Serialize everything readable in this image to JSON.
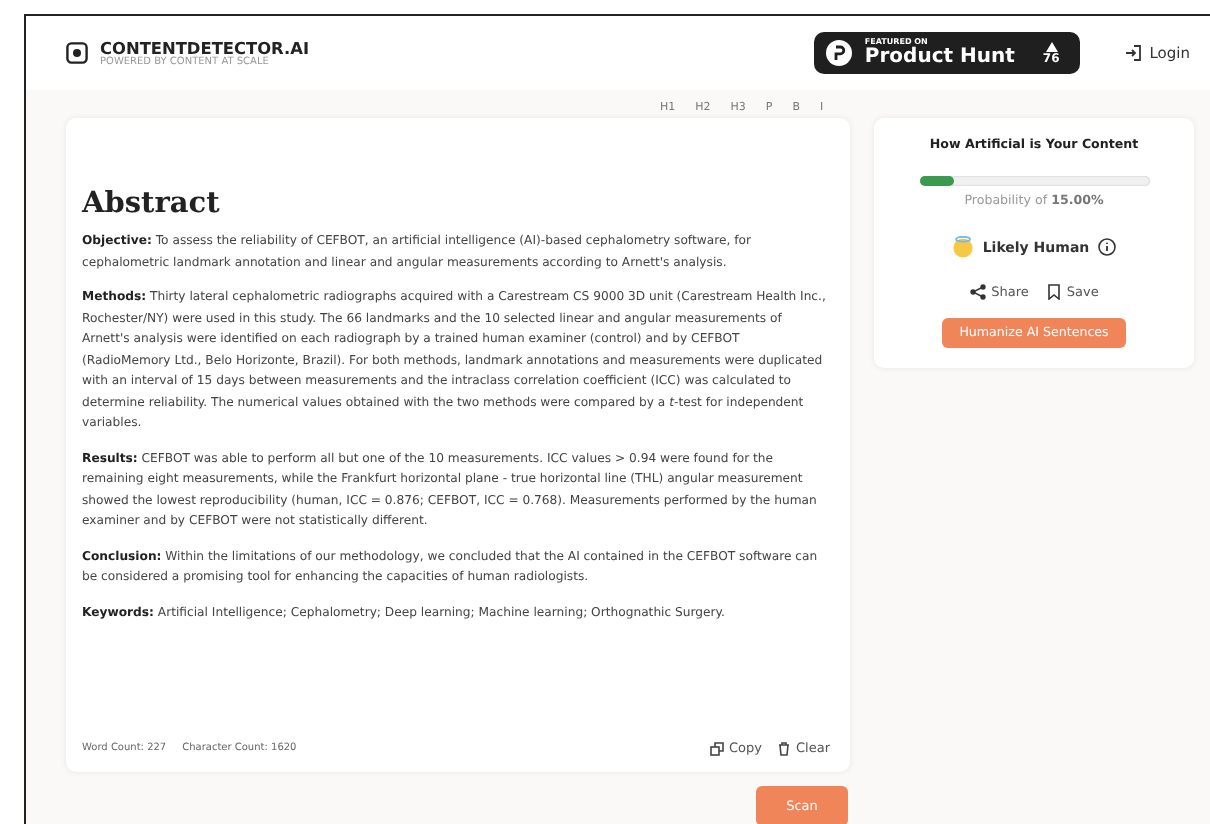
{
  "header": {
    "brand": "CONTENTDETECTOR.AI",
    "tagline": "POWERED BY CONTENT AT SCALE",
    "badge": {
      "small": "FEATURED ON",
      "name": "Product Hunt",
      "votes": "76"
    },
    "login": "Login"
  },
  "toolbar": [
    "H1",
    "H2",
    "H3",
    "P",
    "B",
    "I"
  ],
  "editor": {
    "heading": "Abstract",
    "paragraphs": [
      "**Objective:** To assess the reliability of CEFBOT, an artificial intelligence (AI)-based cephalometry software, for cephalometric landmark annotation and linear and angular measurements according to Arnett's analysis.",
      "**Methods:** Thirty lateral cephalometric radiographs acquired with a Carestream CS 9000 3D unit (Carestream Health Inc., Rochester/NY) were used in this study. The 66 landmarks and the 10 selected linear and angular measurements of Arnett's analysis were identified on each radiograph by a trained human examiner (control) and by CEFBOT (RadioMemory Ltd., Belo Horizonte, Brazil). For both methods, landmark annotations and measurements were duplicated with an interval of 15 days between measurements and the intraclass correlation coefficient (ICC) was calculated to determine reliability. The numerical values obtained with the two methods were compared by a *t*-test for independent variables.",
      "**Results:** CEFBOT was able to perform all but one of the 10 measurements. ICC values > 0.94 were found for the remaining eight measurements, while the Frankfurt horizontal plane - true horizontal line (THL) angular measurement showed the lowest reproducibility (human, ICC = 0.876; CEFBOT, ICC = 0.768). Measurements performed by the human examiner and by CEFBOT were not statistically different.",
      "**Conclusion:** Within the limitations of our methodology, we concluded that the AI contained in the CEFBOT software can be considered a promising tool for enhancing the capacities of human radiologists.",
      "**Keywords:** Artificial Intelligence; Cephalometry; Deep learning; Machine learning; Orthognathic Surgery."
    ],
    "word_count": "Word Count: 227",
    "char_count": "Character Count: 1620",
    "copy": "Copy",
    "clear": "Clear"
  },
  "scan": "Scan",
  "result": {
    "title": "How Artificial is Your Content",
    "level": 0.15,
    "probability": "Probability of **15.00%**",
    "verdict": "Likely Human",
    "share": "Share",
    "save": "Save",
    "humanize": "Humanize AI Sentences"
  }
}
